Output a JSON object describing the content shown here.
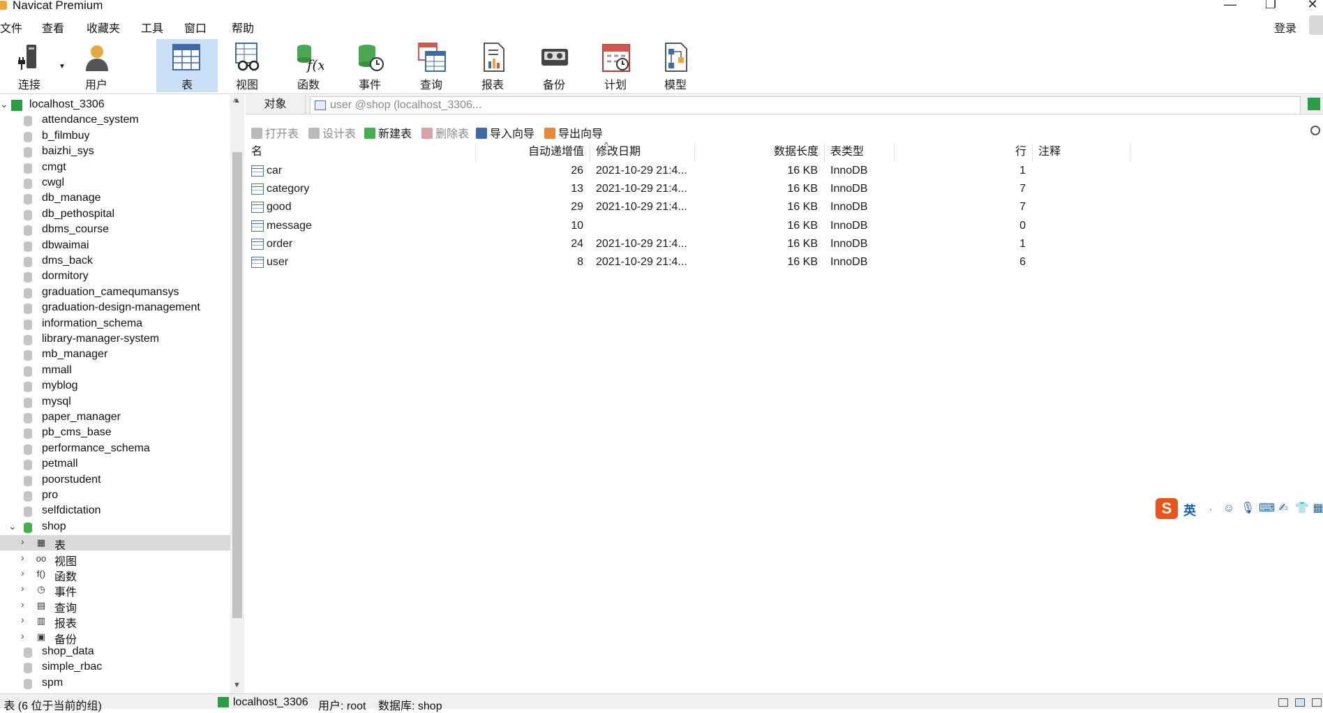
{
  "window": {
    "title": "Navicat Premium",
    "minimize": "—",
    "restore": "❐",
    "close": "✕"
  },
  "menu": [
    "文件",
    "查看",
    "收藏夹",
    "工具",
    "窗口",
    "帮助"
  ],
  "login": "登录",
  "toolbar": [
    {
      "label": "连接",
      "icon": "connect-icon"
    },
    {
      "label": "用户",
      "icon": "user-icon"
    },
    {
      "label": "表",
      "icon": "table-icon",
      "active": true
    },
    {
      "label": "视图",
      "icon": "view-icon"
    },
    {
      "label": "函数",
      "icon": "function-icon"
    },
    {
      "label": "事件",
      "icon": "event-icon"
    },
    {
      "label": "查询",
      "icon": "query-icon"
    },
    {
      "label": "报表",
      "icon": "report-icon"
    },
    {
      "label": "备份",
      "icon": "backup-icon"
    },
    {
      "label": "计划",
      "icon": "schedule-icon"
    },
    {
      "label": "模型",
      "icon": "model-icon"
    }
  ],
  "tree": {
    "connection": "localhost_3306",
    "databases_before": [
      "attendance_system",
      "b_filmbuy",
      "baizhi_sys",
      "cmgt",
      "cwgl",
      "db_manage",
      "db_pethospital",
      "dbms_course",
      "dbwaimai",
      "dms_back",
      "dormitory",
      "graduation_camequmansys",
      "graduation-design-management",
      "information_schema",
      "library-manager-system",
      "mb_manager",
      "mmall",
      "myblog",
      "mysql",
      "paper_manager",
      "pb_cms_base",
      "performance_schema",
      "petmall",
      "poorstudent",
      "pro",
      "selfdictation"
    ],
    "open_db": "shop",
    "open_db_children": [
      {
        "label": "表",
        "icon": "table-icon",
        "selected": true
      },
      {
        "label": "视图",
        "icon": "view-icon"
      },
      {
        "label": "函数",
        "icon": "function-icon"
      },
      {
        "label": "事件",
        "icon": "event-icon"
      },
      {
        "label": "查询",
        "icon": "query-icon"
      },
      {
        "label": "报表",
        "icon": "report-icon"
      },
      {
        "label": "备份",
        "icon": "backup-icon"
      }
    ],
    "databases_after": [
      "shop_data",
      "simple_rbac",
      "spm"
    ]
  },
  "tabs": {
    "objects": "对象",
    "doc": "user @shop (localhost_3306..."
  },
  "object_toolbar": [
    {
      "label": "打开表",
      "enabled": false
    },
    {
      "label": "设计表",
      "enabled": false
    },
    {
      "label": "新建表",
      "enabled": true
    },
    {
      "label": "删除表",
      "enabled": false
    },
    {
      "label": "导入向导",
      "enabled": true
    },
    {
      "label": "导出向导",
      "enabled": true
    }
  ],
  "grid": {
    "columns": [
      "名",
      "自动递增值",
      "修改日期",
      "数据长度",
      "表类型",
      "行",
      "注释"
    ],
    "rows": [
      {
        "name": "car",
        "auto_inc": "26",
        "modified": "2021-10-29 21:4...",
        "data_len": "16 KB",
        "engine": "InnoDB",
        "rows": "1",
        "comment": ""
      },
      {
        "name": "category",
        "auto_inc": "13",
        "modified": "2021-10-29 21:4...",
        "data_len": "16 KB",
        "engine": "InnoDB",
        "rows": "7",
        "comment": ""
      },
      {
        "name": "good",
        "auto_inc": "29",
        "modified": "2021-10-29 21:4...",
        "data_len": "16 KB",
        "engine": "InnoDB",
        "rows": "7",
        "comment": ""
      },
      {
        "name": "message",
        "auto_inc": "10",
        "modified": "",
        "data_len": "16 KB",
        "engine": "InnoDB",
        "rows": "0",
        "comment": ""
      },
      {
        "name": "order",
        "auto_inc": "24",
        "modified": "2021-10-29 21:4...",
        "data_len": "16 KB",
        "engine": "InnoDB",
        "rows": "1",
        "comment": ""
      },
      {
        "name": "user",
        "auto_inc": "8",
        "modified": "2021-10-29 21:4...",
        "data_len": "16 KB",
        "engine": "InnoDB",
        "rows": "6",
        "comment": ""
      }
    ]
  },
  "ime": {
    "logo": "S",
    "mode": "英"
  },
  "status": {
    "left": "5 表 (6 位于当前的组)",
    "connection": "localhost_3306",
    "user": "用户: root",
    "database": "数据库: shop"
  }
}
